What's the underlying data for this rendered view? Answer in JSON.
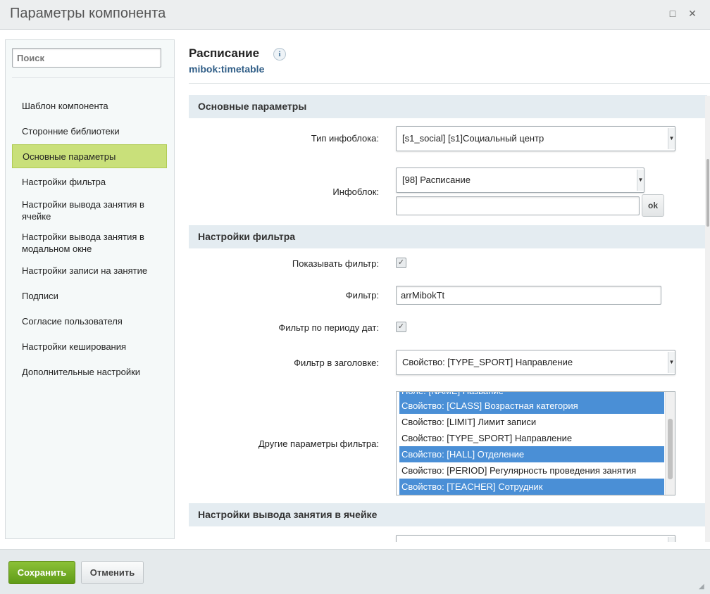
{
  "window": {
    "title": "Параметры компонента",
    "maximize_icon": "□",
    "close_icon": "✕"
  },
  "sidebar": {
    "search_placeholder": "Поиск",
    "items": [
      {
        "label": "Шаблон компонента"
      },
      {
        "label": "Сторонние библиотеки"
      },
      {
        "label": "Основные параметры",
        "active": true
      },
      {
        "label": "Настройки фильтра"
      },
      {
        "label": "Настройки вывода занятия в ячейке"
      },
      {
        "label": "Настройки вывода занятия в модальном окне"
      },
      {
        "label": "Настройки записи на занятие"
      },
      {
        "label": "Подписи"
      },
      {
        "label": "Согласие пользователя"
      },
      {
        "label": "Настройки кеширования"
      },
      {
        "label": "Дополнительные настройки"
      }
    ]
  },
  "component": {
    "name": "Расписание",
    "info_icon": "i",
    "code": "mibok:timetable"
  },
  "sections": {
    "main": "Основные параметры",
    "filter": "Настройки фильтра",
    "cell": "Настройки вывода занятия в ячейке"
  },
  "fields": {
    "iblock_type": {
      "label": "Тип инфоблока:",
      "value": "[s1_social] [s1]Социальный центр"
    },
    "iblock": {
      "label": "Инфоблок:",
      "value": "[98] Расписание",
      "input_value": "",
      "ok_label": "ok"
    },
    "show_filter": {
      "label": "Показывать фильтр:",
      "checked": true
    },
    "filter": {
      "label": "Фильтр:",
      "value": "arrMibokTt"
    },
    "date_filter": {
      "label": "Фильтр по периоду дат:",
      "checked": true
    },
    "header_filter": {
      "label": "Фильтр в заголовке:",
      "value": "Свойство: [TYPE_SPORT] Направление"
    },
    "other_filter": {
      "label": "Другие параметры фильтра:",
      "options": [
        {
          "text": "Поле: [NAME] Название",
          "selected": true
        },
        {
          "text": "Свойство: [CLASS] Возрастная категория",
          "selected": true
        },
        {
          "text": "Свойство: [LIMIT] Лимит записи",
          "selected": false
        },
        {
          "text": "Свойство: [TYPE_SPORT] Направление",
          "selected": false
        },
        {
          "text": "Свойство: [HALL] Отделение",
          "selected": true
        },
        {
          "text": "Свойство: [PERIOD] Регулярность проведения занятия",
          "selected": false
        },
        {
          "text": "Свойство: [TEACHER] Сотрудник",
          "selected": true
        }
      ]
    }
  },
  "footer": {
    "save_label": "Сохранить",
    "cancel_label": "Отменить"
  }
}
